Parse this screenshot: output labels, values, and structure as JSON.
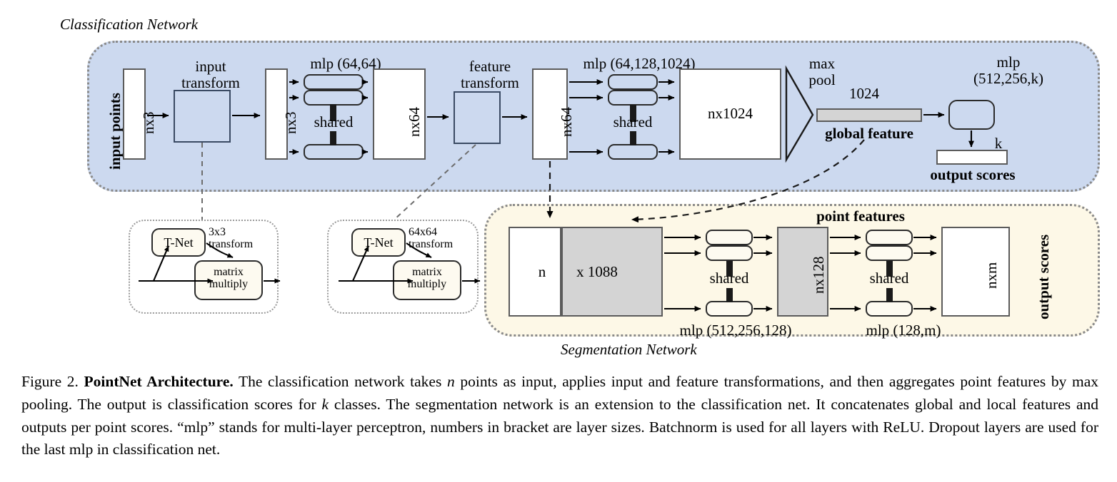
{
  "figure": {
    "classification_title": "Classification Network",
    "segmentation_title": "Segmentation Network"
  },
  "classification": {
    "input_points_label": "input points",
    "input_tensor": "nx3",
    "input_transform_label": "input\ntransform",
    "input_transform_line1": "input",
    "input_transform_line2": "transform",
    "transformed_tensor": "nx3",
    "mlp1_label": "mlp (64,64)",
    "shared1_label": "shared",
    "feat64_tensor": "nx64",
    "feature_transform_line1": "feature",
    "feature_transform_line2": "transform",
    "feat64b_tensor": "nx64",
    "mlp2_label": "mlp (64,128,1024)",
    "shared2_label": "shared",
    "feat1024_tensor": "nx1024",
    "maxpool_line1": "max",
    "maxpool_line2": "pool",
    "global_dim": "1024",
    "global_feature_label": "global feature",
    "mlp3_line1": "mlp",
    "mlp3_line2": "(512,256,k)",
    "k_label": "k",
    "output_scores_label": "output scores"
  },
  "tnet_input": {
    "tnet_label": "T-Net",
    "transform_line1": "3x3",
    "transform_line2": "transform",
    "matrix_line1": "matrix",
    "matrix_line2": "multiply"
  },
  "tnet_feature": {
    "tnet_label": "T-Net",
    "transform_line1": "64x64",
    "transform_line2": "transform",
    "matrix_line1": "matrix",
    "matrix_line2": "multiply"
  },
  "segmentation": {
    "concat_n": "n",
    "concat_dim": "x 1088",
    "point_features_label": "point features",
    "mlp4_label": "mlp (512,256,128)",
    "shared3_label": "shared",
    "feat128_tensor": "nx128",
    "mlp5_label": "mlp (128,m)",
    "shared4_label": "shared",
    "output_tensor": "nxm",
    "output_scores_label": "output scores"
  },
  "caption": {
    "prefix": "Figure 2.",
    "bold_title": "PointNet Architecture.",
    "body_1": " The classification network takes ",
    "italic_n": "n",
    "body_2": " points as input, applies input and feature transformations, and then aggregates point features by max pooling. The output is classification scores for ",
    "italic_k": "k",
    "body_3": " classes. The segmentation network is an extension to the classification net. It concatenates global and local features and outputs per point scores. “mlp” stands for multi-layer perceptron, numbers in bracket are layer sizes. Batchnorm is used for all layers with ReLU. Dropout layers are used for the last mlp in classification net."
  },
  "colors": {
    "classification_panel": "#ccd9ef",
    "segmentation_panel": "#fdf8e7",
    "grey_tensor": "#d4d4d4",
    "panel_border": "#8a8a8a",
    "stroke": "#000000"
  }
}
